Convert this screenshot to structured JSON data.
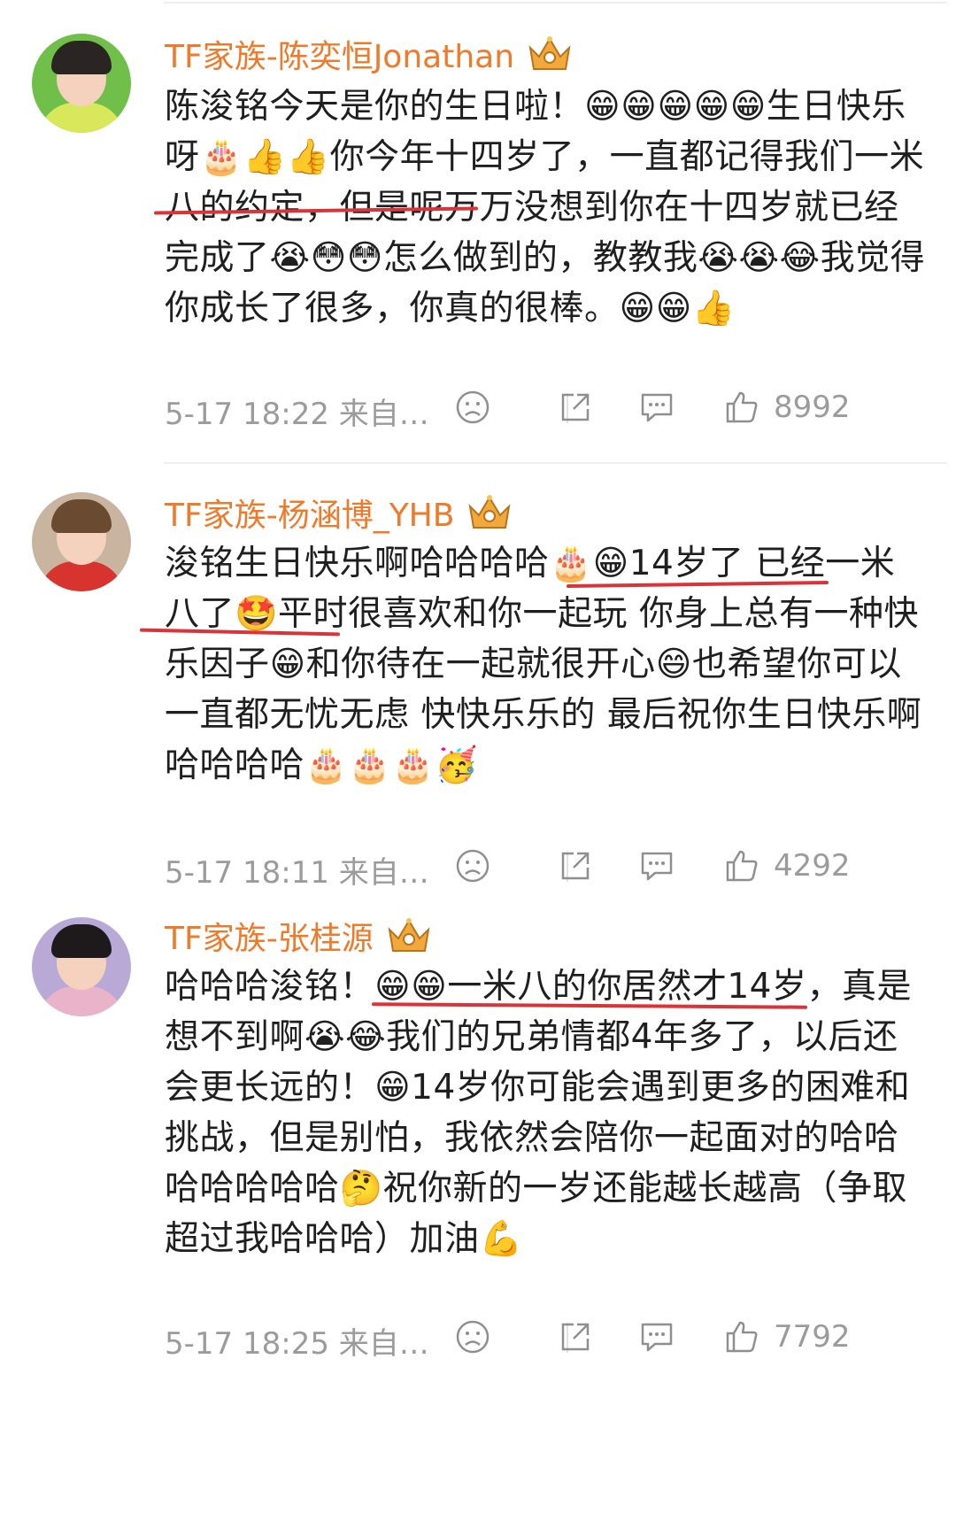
{
  "comments": [
    {
      "username": "TF家族-陈奕恒Jonathan",
      "text": "陈浚铭今天是你的生日啦！😁😁😁😁😁生日快乐呀🎂👍👍你今年十四岁了，一直都记得我们一米八的约定，但是呢万万没想到你在十四岁就已经完成了😭😳😳怎么做到的，教教我😭😭😂我觉得你成长了很多，你真的很棒。😁😁👍",
      "time": "5-17 18:22 来自…",
      "likes": "8992",
      "avatar_colors": {
        "bg": "#6fbf4a",
        "hair": "#2a2422",
        "shirt": "#d9e85a"
      }
    },
    {
      "username": "TF家族-杨涵博_YHB",
      "text": "浚铭生日快乐啊哈哈哈哈🎂😁14岁了 已经一米八了🤩平时很喜欢和你一起玩 你身上总有一种快乐因子😁和你待在一起就很开心😄也希望你可以一直都无忧无虑 快快乐乐的 最后祝你生日快乐啊哈哈哈哈🎂🎂🎂🥳",
      "time": "5-17 18:11 来自…",
      "likes": "4292",
      "avatar_colors": {
        "bg": "#c9b59f",
        "hair": "#6b4a32",
        "shirt": "#d8342f"
      }
    },
    {
      "username": "TF家族-张桂源",
      "text": "哈哈哈浚铭！😁😁一米八的你居然才14岁，真是想不到啊😭😂我们的兄弟情都4年多了，以后还会更长远的！😁14岁你可能会遇到更多的困难和挑战，但是别怕，我依然会陪你一起面对的哈哈哈哈哈哈哈🤔祝你新的一岁还能越长越高（争取超过我哈哈哈）加油💪",
      "time": "5-17 18:25 来自…",
      "likes": "7792",
      "avatar_colors": {
        "bg": "#b9a9d6",
        "hair": "#1e1a1c",
        "shirt": "#e9b3c9"
      }
    }
  ],
  "icons": {
    "crown": "crown-badge-icon",
    "dislike": "dislike-face-icon",
    "repost": "repost-icon",
    "comment": "comment-bubble-icon",
    "like": "thumbs-up-icon"
  },
  "colors": {
    "username": "#ee7a2a",
    "meta_text": "#9b9b9b",
    "highlight_underline": "#d8353b"
  }
}
